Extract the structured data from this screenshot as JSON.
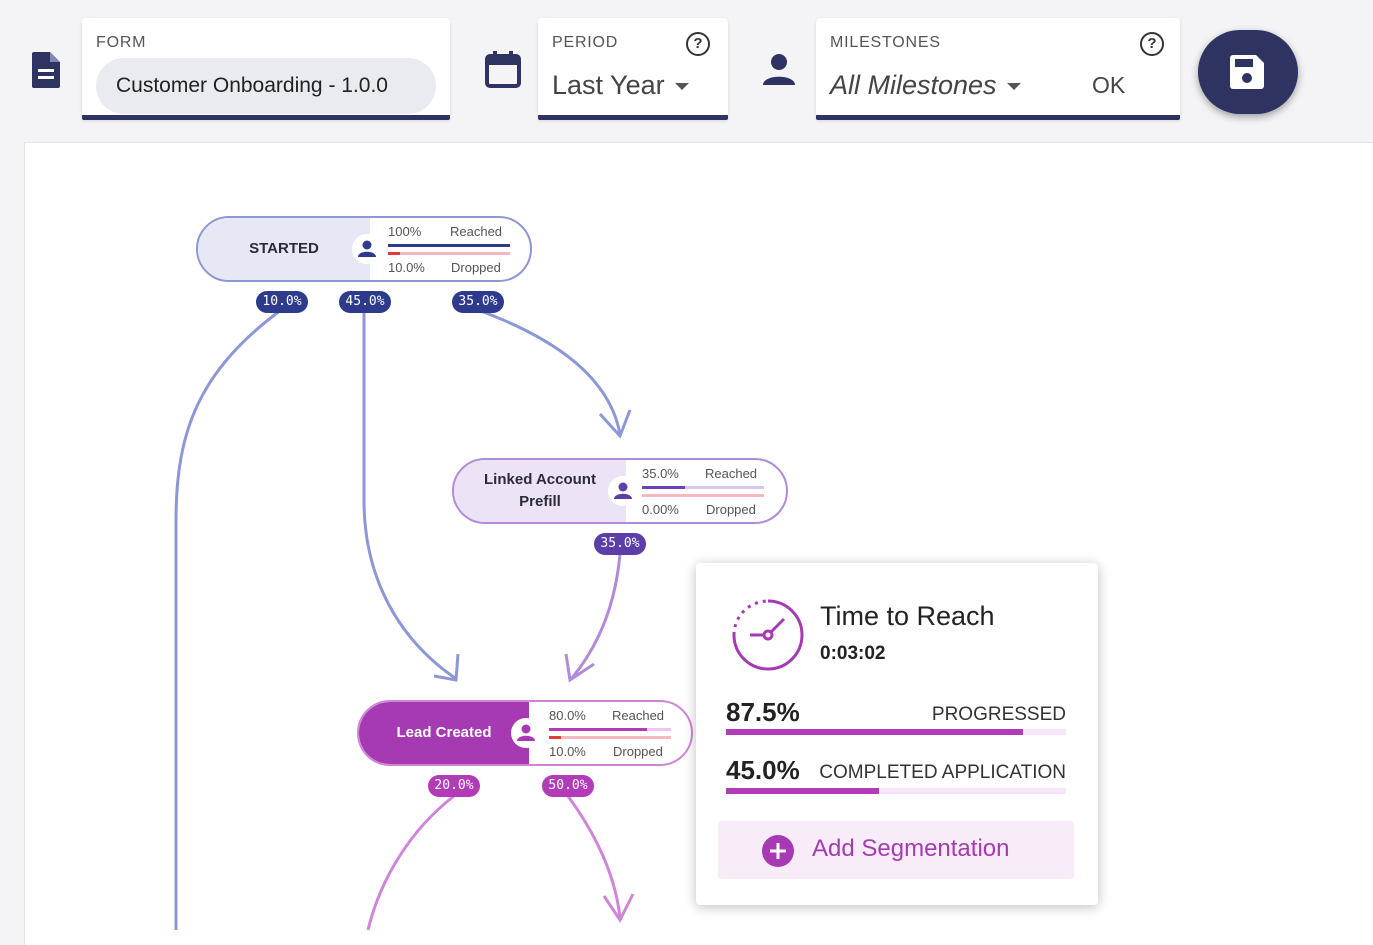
{
  "toolbar": {
    "form": {
      "label": "FORM",
      "value": "Customer Onboarding - 1.0.0"
    },
    "period": {
      "label": "PERIOD",
      "value": "Last Year"
    },
    "milestones": {
      "label": "MILESTONES",
      "value": "All Milestones",
      "ok_label": "OK"
    },
    "help_glyph": "?"
  },
  "nodes": {
    "started": {
      "name": "STARTED",
      "reached_pct": "100%",
      "reached_label": "Reached",
      "dropped_pct": "10.0%",
      "dropped_label": "Dropped",
      "reached_value": 1.0,
      "dropped_value": 0.1
    },
    "linked": {
      "name_line1": "Linked Account",
      "name_line2": "Prefill",
      "reached_pct": "35.0%",
      "reached_label": "Reached",
      "dropped_pct": "0.00%",
      "dropped_label": "Dropped",
      "reached_value": 0.35,
      "dropped_value": 0.0
    },
    "lead": {
      "name": "Lead Created",
      "reached_pct": "80.0%",
      "reached_label": "Reached",
      "dropped_pct": "10.0%",
      "dropped_label": "Dropped",
      "reached_value": 0.8,
      "dropped_value": 0.1
    }
  },
  "edges": {
    "started_a": "10.0%",
    "started_b": "45.0%",
    "started_c": "35.0%",
    "linked_a": "35.0%",
    "lead_a": "20.0%",
    "lead_b": "50.0%"
  },
  "popup": {
    "title": "Time to Reach",
    "time": "0:03:02",
    "progressed_pct": "87.5%",
    "progressed_label": "PROGRESSED",
    "progressed_value": 0.875,
    "completed_pct": "45.0%",
    "completed_label": "COMPLETED APPLICATION",
    "completed_value": 0.45,
    "add_segmentation": "Add Segmentation"
  },
  "colors": {
    "navy": "#2f3361",
    "indigo": "#2e3a8c",
    "edge_blue": "#8e97d6",
    "node_light": "#e6e8f6",
    "purple": "#a53ab3",
    "magenta": "#b23bb8",
    "edge_pink": "#cf86d8",
    "dropped_red": "#e53935",
    "dropped_pink": "#f5b8c0"
  }
}
